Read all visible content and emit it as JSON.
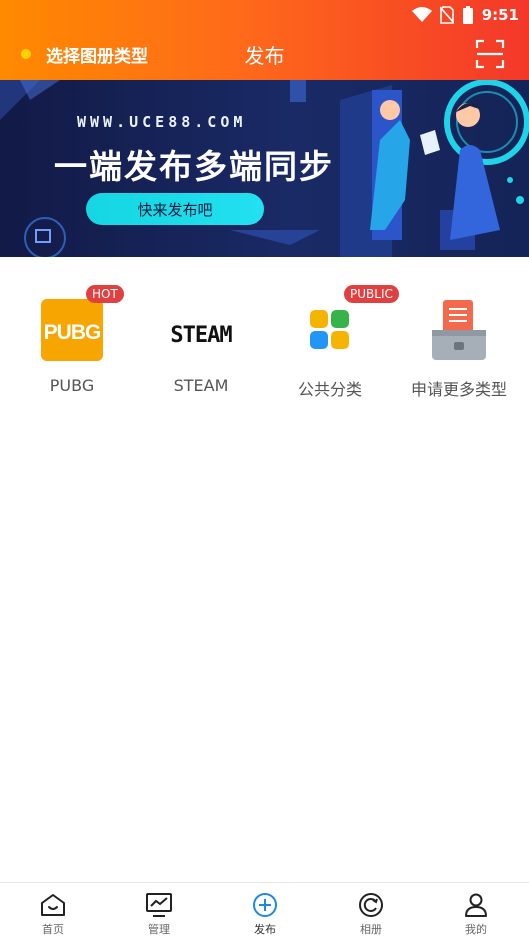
{
  "status_bar": {
    "time": "9:51"
  },
  "header": {
    "choose_type": "选择图册类型",
    "title": "发布"
  },
  "banner": {
    "url": "WWW.UCE88.COM",
    "slogan": "一端发布多端同步",
    "button": "快来发布吧"
  },
  "categories": [
    {
      "label": "PUBG",
      "badge": "HOT",
      "logo_text": "PUBG"
    },
    {
      "label": "STEAM",
      "logo_text": "STEAM"
    },
    {
      "label": "公共分类",
      "badge": "PUBLIC"
    },
    {
      "label": "申请更多类型"
    }
  ],
  "tabs": [
    {
      "label": "首页",
      "icon": "home-icon"
    },
    {
      "label": "管理",
      "icon": "monitor-chart-icon"
    },
    {
      "label": "发布",
      "icon": "plus-circle-icon",
      "active": true
    },
    {
      "label": "相册",
      "icon": "refresh-circle-icon"
    },
    {
      "label": "我的",
      "icon": "user-icon"
    }
  ],
  "colors": {
    "header_start": "#ff8a00",
    "header_end": "#f3382a",
    "badge": "#e0403f",
    "active_tab": "#1e88e5",
    "banner_button": "#15d6e2"
  }
}
